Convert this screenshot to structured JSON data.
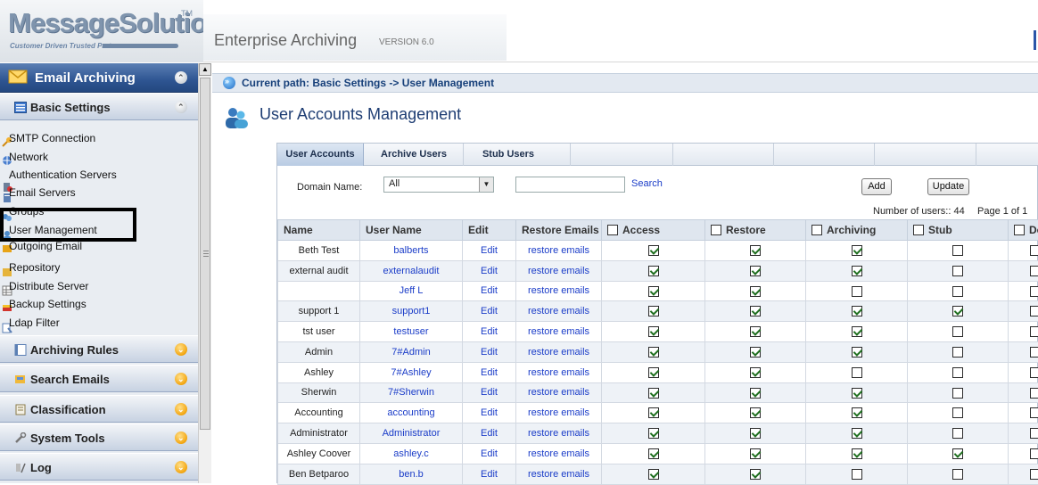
{
  "header": {
    "logo_text": "MessageSolution",
    "logo_tm": "TM",
    "logo_tagline": "Customer Driven Trusted Partner",
    "title": "Enterprise Archiving",
    "version": "VERSION 6.0"
  },
  "sidebar": {
    "section_title": "Email Archiving",
    "basic_settings": "Basic Settings",
    "items": [
      {
        "label": "SMTP Connection",
        "icon": "plug-icon"
      },
      {
        "label": "Network",
        "icon": "network-icon"
      },
      {
        "label": "Authentication Servers",
        "icon": "auth-server-icon"
      },
      {
        "label": "Email Servers",
        "icon": "email-server-icon"
      },
      {
        "label": "Groups",
        "icon": "groups-icon"
      },
      {
        "label": "User Management",
        "icon": "user-icon"
      },
      {
        "label": "Outgoing Email",
        "icon": "outgoing-email-icon"
      },
      {
        "label": "Repository",
        "icon": "repository-icon"
      },
      {
        "label": "Distribute Server",
        "icon": "distribute-server-icon"
      },
      {
        "label": "Backup Settings",
        "icon": "backup-icon"
      },
      {
        "label": "Ldap Filter",
        "icon": "ldap-filter-icon"
      }
    ],
    "categories": [
      {
        "label": "Archiving Rules"
      },
      {
        "label": "Search Emails"
      },
      {
        "label": "Classification"
      },
      {
        "label": "System Tools"
      },
      {
        "label": "Log"
      }
    ]
  },
  "main": {
    "current_path": "Current path: Basic Settings -> User Management",
    "page_title": "User Accounts Management",
    "tabs": [
      "User Accounts",
      "Archive Users",
      "Stub Users"
    ],
    "domain_label": "Domain Name:",
    "domain_value": "All",
    "search_label": "Search",
    "add_label": "Add",
    "update_label": "Update",
    "users_count": "Number of users:: 44",
    "page_info": "Page 1 of 1",
    "columns": [
      "Name",
      "User Name",
      "Edit",
      "Restore Emails",
      "Access",
      "Restore",
      "Archiving",
      "Stub",
      "De"
    ],
    "edit_label": "Edit",
    "restore_label": "restore emails",
    "rows": [
      {
        "name": "Beth Test",
        "username": "balberts",
        "access": true,
        "restore": true,
        "archiving": true,
        "stub": false,
        "de": false
      },
      {
        "name": "external audit",
        "username": "externalaudit",
        "access": true,
        "restore": true,
        "archiving": true,
        "stub": false,
        "de": false
      },
      {
        "name": "",
        "username": "Jeff L",
        "access": true,
        "restore": true,
        "archiving": false,
        "stub": false,
        "de": false
      },
      {
        "name": "support 1",
        "username": "support1",
        "access": true,
        "restore": true,
        "archiving": true,
        "stub": true,
        "de": false
      },
      {
        "name": "tst user",
        "username": "testuser",
        "access": true,
        "restore": true,
        "archiving": true,
        "stub": false,
        "de": false
      },
      {
        "name": "Admin",
        "username": "7#Admin",
        "access": true,
        "restore": true,
        "archiving": true,
        "stub": false,
        "de": false
      },
      {
        "name": "Ashley",
        "username": "7#Ashley",
        "access": true,
        "restore": true,
        "archiving": false,
        "stub": false,
        "de": false
      },
      {
        "name": "Sherwin",
        "username": "7#Sherwin",
        "access": true,
        "restore": true,
        "archiving": true,
        "stub": false,
        "de": false
      },
      {
        "name": "Accounting",
        "username": "accounting",
        "access": true,
        "restore": true,
        "archiving": true,
        "stub": false,
        "de": false
      },
      {
        "name": "Administrator",
        "username": "Administrator",
        "access": true,
        "restore": true,
        "archiving": true,
        "stub": false,
        "de": false
      },
      {
        "name": "Ashley Coover",
        "username": "ashley.c",
        "access": true,
        "restore": true,
        "archiving": true,
        "stub": true,
        "de": false
      },
      {
        "name": "Ben Betparoo",
        "username": "ben.b",
        "access": true,
        "restore": true,
        "archiving": false,
        "stub": false,
        "de": false
      }
    ]
  },
  "colors": {
    "section_blue": "#2e5592",
    "accent_orange": "#f3a50f",
    "link_blue": "#1a3cc8",
    "check_green": "#1f6f1f"
  }
}
